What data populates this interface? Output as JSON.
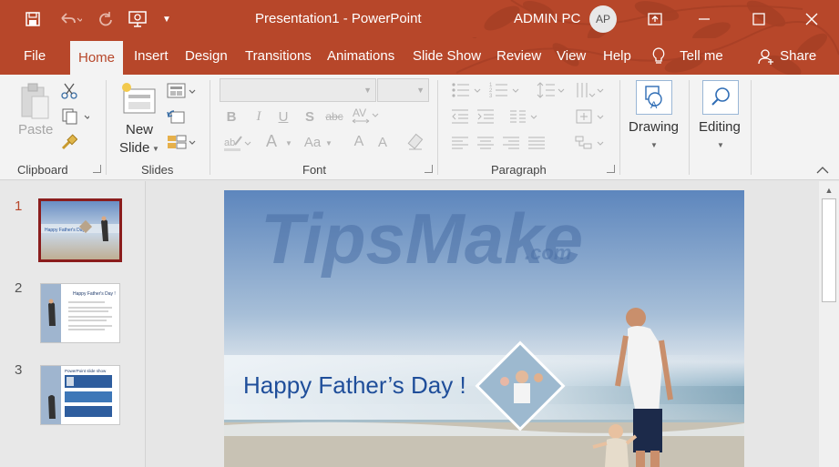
{
  "window": {
    "title": "Presentation1  -  PowerPoint",
    "user_name": "ADMIN PC",
    "avatar_initials": "AP"
  },
  "colors": {
    "accent": "#b7472a",
    "ribbon_bg": "#f3f3f3",
    "slide_title": "#1f4e9a"
  },
  "quick_access": {
    "icons": [
      "save-icon",
      "undo-icon",
      "redo-icon",
      "present-from-beginning-icon",
      "customize-qat-icon"
    ]
  },
  "tabs": [
    {
      "label": "File"
    },
    {
      "label": "Home",
      "active": true
    },
    {
      "label": "Insert"
    },
    {
      "label": "Design"
    },
    {
      "label": "Transitions"
    },
    {
      "label": "Animations"
    },
    {
      "label": "Slide Show"
    },
    {
      "label": "Review"
    },
    {
      "label": "View"
    },
    {
      "label": "Help"
    }
  ],
  "tell_me": "Tell me",
  "share": "Share",
  "ribbon": {
    "clipboard": {
      "label": "Clipboard",
      "paste": "Paste"
    },
    "slides": {
      "label": "Slides",
      "new_slide_line1": "New",
      "new_slide_line2": "Slide"
    },
    "font": {
      "label": "Font",
      "bold": "B",
      "italic": "I",
      "underline": "U",
      "shadow": "S",
      "strike": "abc",
      "grow": "A",
      "shrink": "A",
      "case": "Aa",
      "color": "A"
    },
    "paragraph": {
      "label": "Paragraph"
    },
    "drawing": {
      "label": "Drawing"
    },
    "editing": {
      "label": "Editing"
    }
  },
  "thumbnails": [
    {
      "number": "1",
      "selected": true,
      "caption": "Happy Father's Day !"
    },
    {
      "number": "2",
      "selected": false,
      "caption": "Happy Father's Day !"
    },
    {
      "number": "3",
      "selected": false,
      "caption": "PowerPoint slide show"
    }
  ],
  "slide": {
    "watermark_main": "TipsMake",
    "watermark_suffix": ".com",
    "title": "Happy Father’s Day !"
  }
}
